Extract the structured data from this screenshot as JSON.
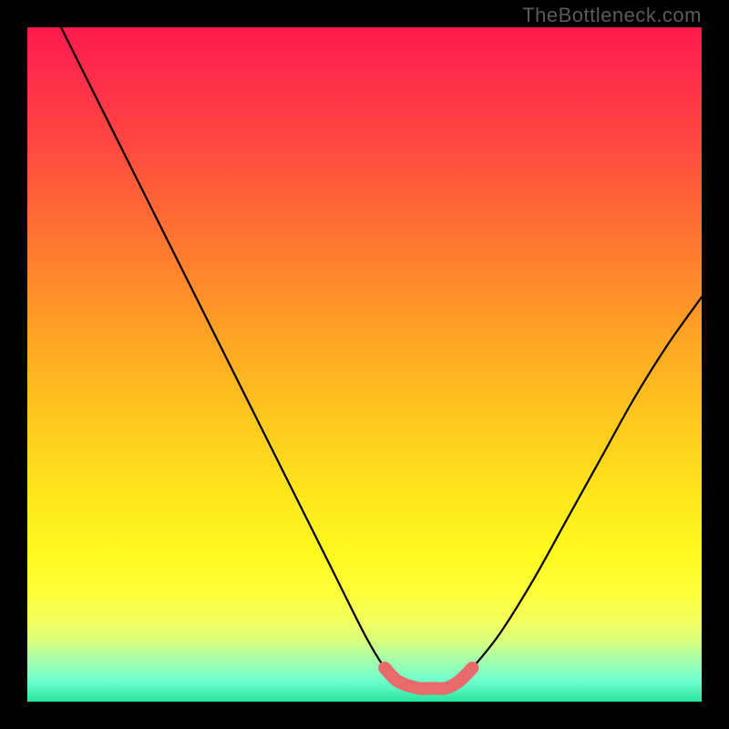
{
  "watermark": "TheBottleneck.com",
  "chart_data": {
    "type": "line",
    "title": "",
    "xlabel": "",
    "ylabel": "",
    "xlim": [
      0,
      100
    ],
    "ylim": [
      0,
      100
    ],
    "grid": false,
    "legend": false,
    "annotations": [],
    "series": [
      {
        "name": "bottleneck-curve",
        "color": "#000000",
        "x": [
          5,
          10,
          15,
          20,
          25,
          30,
          35,
          40,
          45,
          50,
          53,
          55,
          58,
          60,
          62,
          64,
          66,
          70,
          75,
          80,
          85,
          90,
          95,
          100
        ],
        "values": [
          100,
          90,
          80,
          70,
          60,
          50,
          40,
          30,
          20,
          10,
          5,
          3,
          2,
          2,
          2,
          3,
          5,
          10,
          18,
          27,
          36,
          45,
          53,
          60
        ]
      },
      {
        "name": "highlight-bottom",
        "color": "#e86a6a",
        "x": [
          53,
          55,
          58,
          60,
          62,
          64,
          66
        ],
        "values": [
          5,
          3,
          2,
          2,
          2,
          3,
          5
        ]
      }
    ],
    "background_gradient": {
      "top": "#ff1a4d",
      "mid_high": "#ff8a2a",
      "mid": "#ffe31c",
      "mid_low": "#feff3a",
      "bottom": "#26e59d"
    }
  }
}
